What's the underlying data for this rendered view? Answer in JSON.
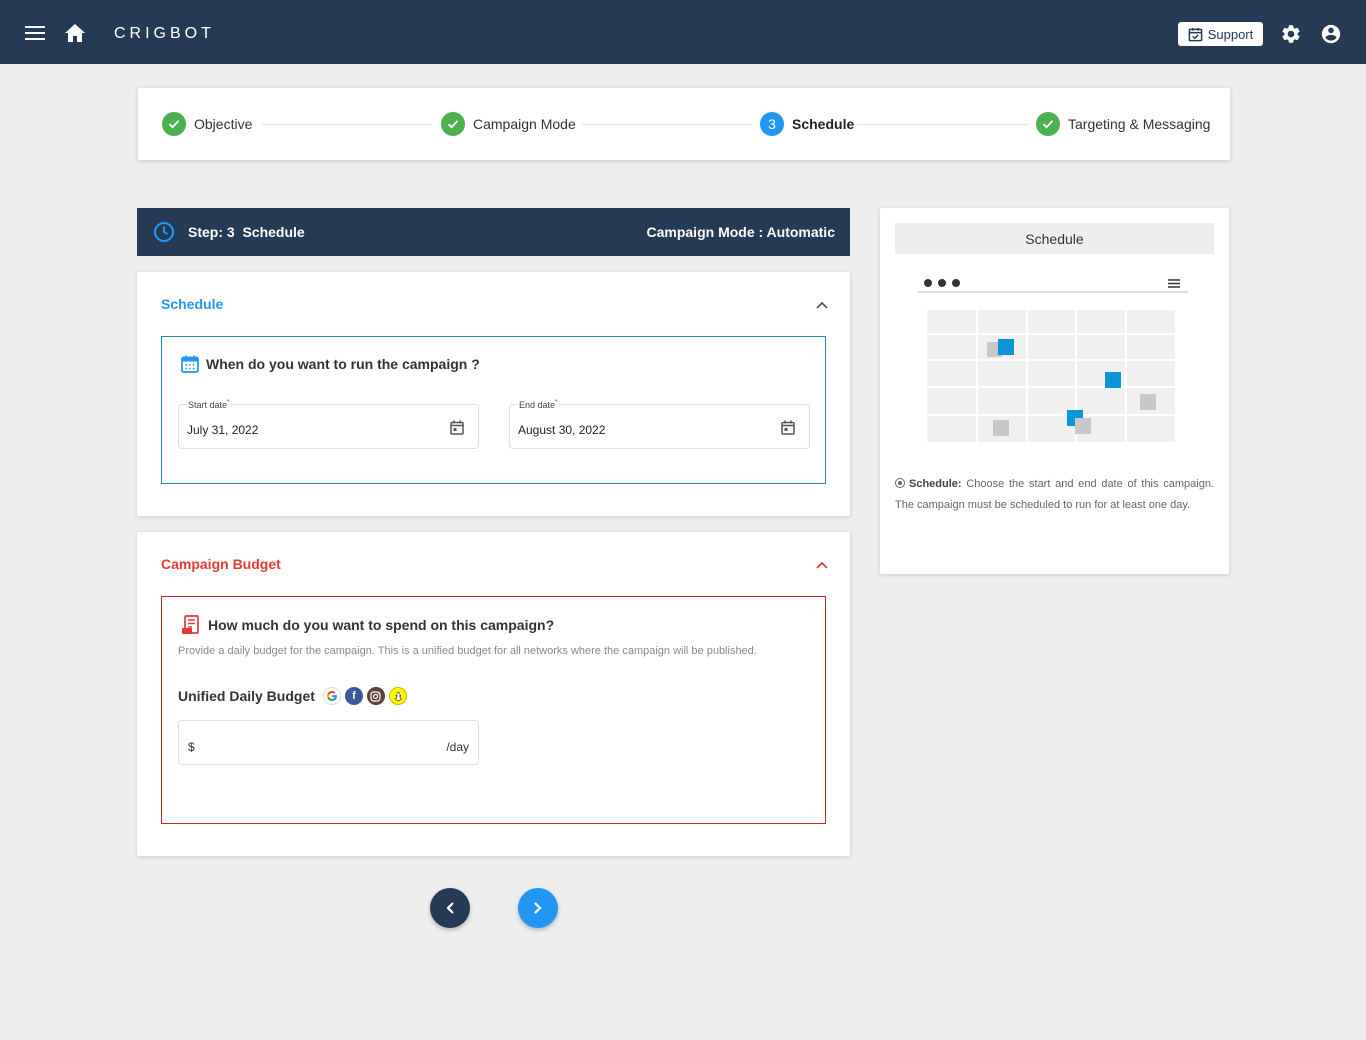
{
  "header": {
    "brand": "CRIGBOT",
    "support_label": "Support"
  },
  "stepper": {
    "steps": [
      {
        "label": "Objective",
        "status": "done"
      },
      {
        "label": "Campaign Mode",
        "status": "done"
      },
      {
        "label": "Schedule",
        "status": "active",
        "number": "3"
      },
      {
        "label": "Targeting & Messaging",
        "status": "done"
      }
    ]
  },
  "step_header": {
    "title": "Step: 3  Schedule",
    "mode": "Campaign Mode : Automatic"
  },
  "schedule_card": {
    "title": "Schedule",
    "question": "When do you want to run the campaign ?",
    "start_date": {
      "label": "Start date",
      "value": "July 31, 2022"
    },
    "end_date": {
      "label": "End date",
      "value": "August 30, 2022"
    }
  },
  "budget_card": {
    "title": "Campaign Budget",
    "question": "How much do you want to spend on this campaign?",
    "description": "Provide a daily budget for the campaign. This is a unified budget for all networks where the campaign will be published.",
    "budget_label": "Unified Daily Budget",
    "networks": [
      "google-icon",
      "facebook-icon",
      "instagram-icon",
      "snapchat-icon"
    ],
    "currency_prefix": "$",
    "unit_suffix": "/day",
    "value": ""
  },
  "info_panel": {
    "title": "Schedule",
    "text_bold": "Schedule:",
    "text": "Choose the start and end date of this campaign. The campaign must be scheduled to run for at least one day."
  },
  "colors": {
    "navy": "#253a55",
    "primary_blue": "#2196f3",
    "success_green": "#4caf50",
    "schedule_accent": "#2196f3",
    "budget_accent": "#e53935"
  }
}
